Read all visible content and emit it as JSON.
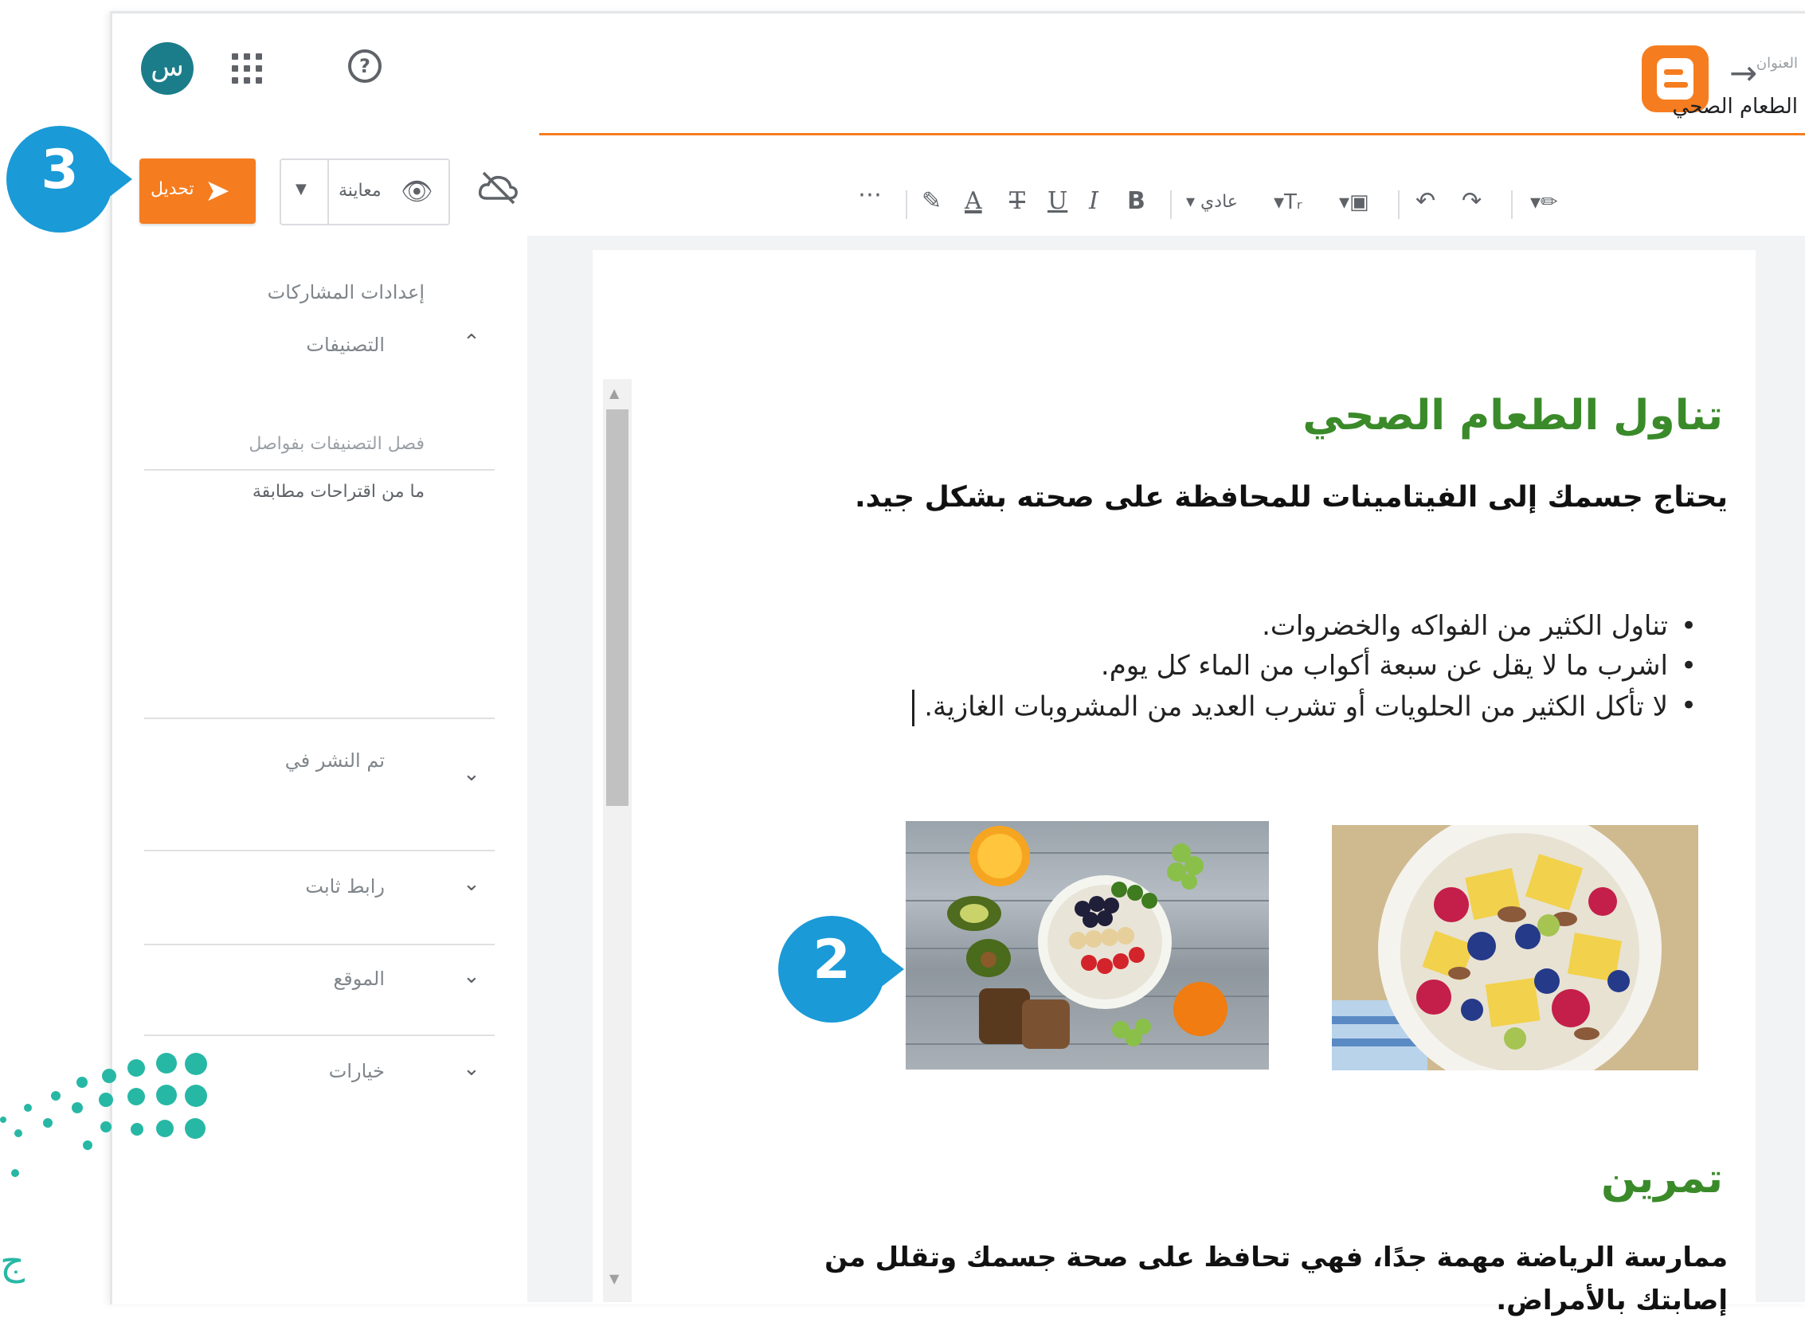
{
  "header": {
    "avatar_letter": "س",
    "apps_icon": "apps-grid-icon",
    "help_icon": "help-icon",
    "logo": "blogger-logo",
    "back_icon": "arrow-right-icon"
  },
  "actions": {
    "publish_label": "تحديل",
    "preview_label": "معاينة"
  },
  "sidebar": {
    "settings_heading": "إعدادات المشاركات",
    "labels_section": "التصنيفات",
    "labels_placeholder": "فصل التصنيفات بفواصل",
    "labels_no_match": "ما من اقتراحات مطابقة",
    "sections": [
      "تم النشر في",
      "رابط ثابت",
      "الموقع",
      "خيارات"
    ]
  },
  "title_field": {
    "caption": "العنوان",
    "value": "الطعام الصحي"
  },
  "toolbar": {
    "normal_label": "عادي",
    "items": [
      "more-icon",
      "highlight-icon",
      "text-color-icon",
      "strikethrough-icon",
      "underline-icon",
      "italic-icon",
      "bold-icon",
      "paragraph-style-icon",
      "font-size-icon",
      "text-background-icon",
      "undo-icon",
      "redo-icon",
      "edit-mode-icon"
    ]
  },
  "post": {
    "heading1": "تناول الطعام الصحي",
    "lead": "يحتاج جسمك إلى الفيتامينات للمحافظة على صحته بشكل جيد.",
    "bullets": [
      "تناول الكثير من الفواكه والخضروات.",
      "اشرب ما لا يقل عن سبعة أكواب من الماء كل يوم.",
      "لا تأكل الكثير من الحلويات أو تشرب العديد من المشروبات الغازية."
    ],
    "heading2": "تمرين",
    "paragraph": "ممارسة الرياضة مهمة جدًا، فهي تحافظ على صحة جسمك وتقلل من إصابتك بالأمراض."
  },
  "callouts": {
    "step2": "2",
    "step3": "3"
  },
  "colors": {
    "accent": "#f57d20",
    "heading_green": "#3a8a2a",
    "callout_blue": "#1a9ad7",
    "avatar_teal": "#1b7d8a",
    "ministry_teal": "#27b8a5"
  }
}
